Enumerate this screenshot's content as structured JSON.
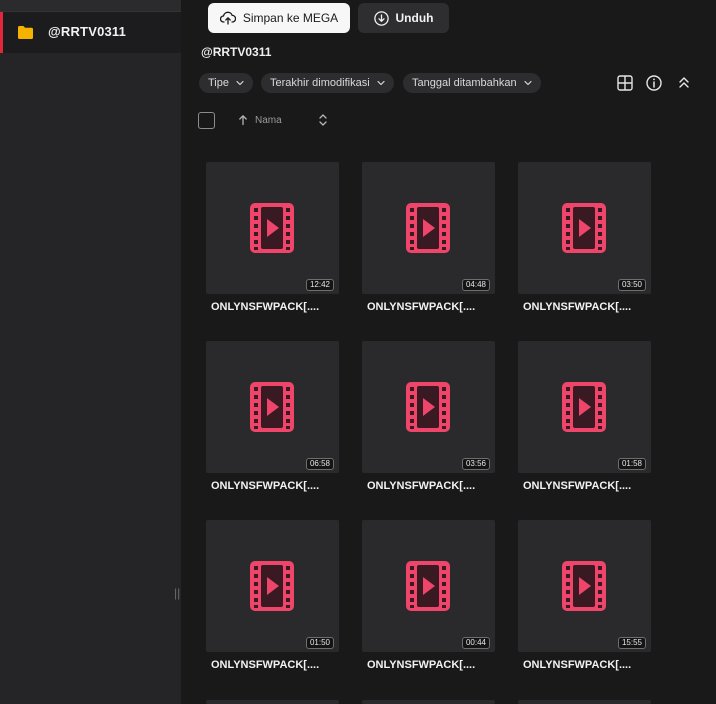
{
  "sidebar": {
    "folder_label": "@RRTV0311",
    "folder_color": "#f5b300",
    "accent_color": "#e0283a"
  },
  "toolbar": {
    "save_label": "Simpan ke MEGA",
    "download_label": "Unduh"
  },
  "breadcrumb": {
    "current": "@RRTV0311"
  },
  "filters": {
    "type_label": "Tipe",
    "modified_label": "Terakhir dimodifikasi",
    "added_label": "Tanggal ditambahkan"
  },
  "view_tools": [
    "grid-view-icon",
    "info-icon",
    "collapse-icon"
  ],
  "sort": {
    "label": "Nama",
    "direction": "ascending"
  },
  "files": [
    {
      "name": "ONLYNSFWPACK[....",
      "duration": "12:42"
    },
    {
      "name": "ONLYNSFWPACK[....",
      "duration": "04:48"
    },
    {
      "name": "ONLYNSFWPACK[....",
      "duration": "03:50"
    },
    {
      "name": "ONLYNSFWPACK[....",
      "duration": "06:58"
    },
    {
      "name": "ONLYNSFWPACK[....",
      "duration": "03:56"
    },
    {
      "name": "ONLYNSFWPACK[....",
      "duration": "01:58"
    },
    {
      "name": "ONLYNSFWPACK[....",
      "duration": "01:50"
    },
    {
      "name": "ONLYNSFWPACK[....",
      "duration": "00:44"
    },
    {
      "name": "ONLYNSFWPACK[....",
      "duration": "15:55"
    }
  ],
  "video_icon_color": "#f0456b"
}
